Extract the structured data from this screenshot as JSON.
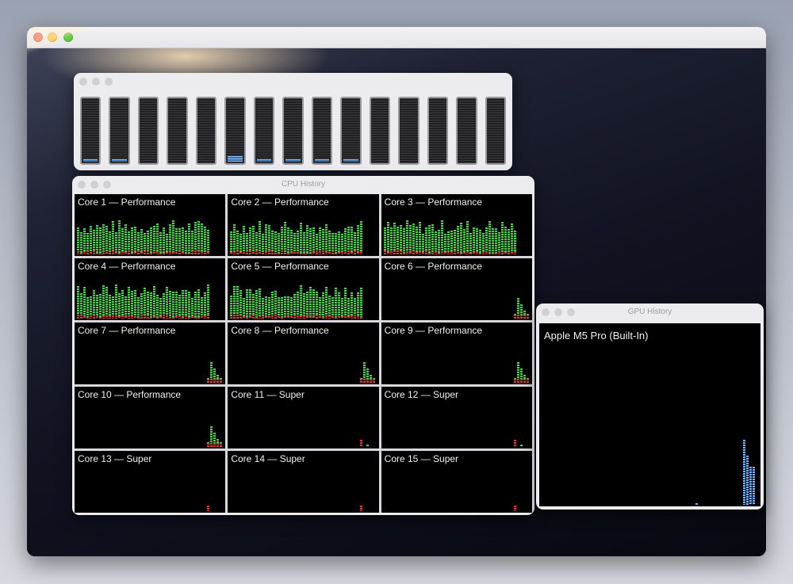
{
  "meters": {
    "levels": [
      0.02,
      0.03,
      0.0,
      0.0,
      0.0,
      0.08,
      0.02,
      0.03,
      0.03,
      0.03,
      0.0,
      0.0,
      0.0,
      0.0,
      0.0
    ]
  },
  "cpu_history": {
    "title": "CPU History",
    "cores": [
      {
        "label": "Core 1 — Performance",
        "activity": "high"
      },
      {
        "label": "Core 2 — Performance",
        "activity": "high"
      },
      {
        "label": "Core 3 — Performance",
        "activity": "high"
      },
      {
        "label": "Core 4 — Performance",
        "activity": "high"
      },
      {
        "label": "Core 5 — Performance",
        "activity": "high"
      },
      {
        "label": "Core 6 — Performance",
        "activity": "low"
      },
      {
        "label": "Core 7 — Performance",
        "activity": "low"
      },
      {
        "label": "Core 8 — Performance",
        "activity": "low"
      },
      {
        "label": "Core 9 — Performance",
        "activity": "low"
      },
      {
        "label": "Core 10 — Performance",
        "activity": "low"
      },
      {
        "label": "Core 11 — Super",
        "activity": "minimal"
      },
      {
        "label": "Core 12 — Super",
        "activity": "minimal"
      },
      {
        "label": "Core 13 — Super",
        "activity": "minimal"
      },
      {
        "label": "Core 14 — Super",
        "activity": "minimal"
      },
      {
        "label": "Core 15 — Super",
        "activity": "minimal"
      }
    ]
  },
  "gpu_history": {
    "title": "GPU History",
    "gpu_name": "Apple M5 Pro (Built-In)"
  },
  "colors": {
    "user_load": "#49d04b",
    "system_load": "#e03a2e",
    "gpu_load": "#6fb3ff",
    "meter_fill": "#8ec3ff"
  }
}
